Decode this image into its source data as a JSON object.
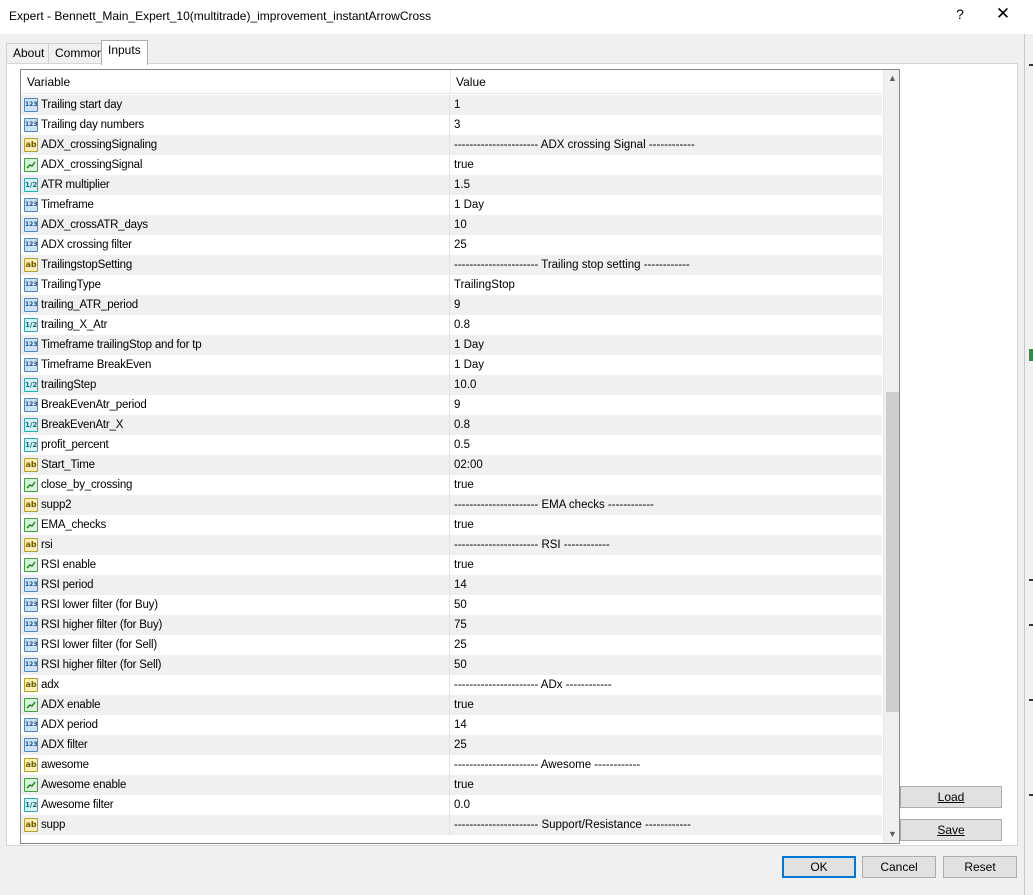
{
  "window": {
    "title": "Expert - Bennett_Main_Expert_10(multitrade)_improvement_instantArrowCross",
    "help_glyph": "?",
    "close_glyph": "✕"
  },
  "tabs": [
    {
      "label": "About"
    },
    {
      "label": "Common"
    },
    {
      "label": "Inputs",
      "active": true
    }
  ],
  "grid": {
    "col_variable": "Variable",
    "col_value": "Value",
    "rows": [
      {
        "type": "int",
        "icon": "int-icon",
        "name": "Trailing start day",
        "value": "1"
      },
      {
        "type": "int",
        "icon": "int-icon",
        "name": "Trailing day numbers",
        "value": "3"
      },
      {
        "type": "str",
        "icon": "string-icon",
        "name": "ADX_crossingSignaling",
        "value": "---------------------- ADX crossing Signal ------------"
      },
      {
        "type": "bool",
        "icon": "bool-icon",
        "name": "ADX_crossingSignal",
        "value": "true"
      },
      {
        "type": "dbl",
        "icon": "double-icon",
        "name": "ATR multiplier",
        "value": "1.5"
      },
      {
        "type": "int",
        "icon": "int-icon",
        "name": "Timeframe",
        "value": "1 Day"
      },
      {
        "type": "int",
        "icon": "int-icon",
        "name": "ADX_crossATR_days",
        "value": "10"
      },
      {
        "type": "int",
        "icon": "int-icon",
        "name": "ADX crossing filter",
        "value": "25"
      },
      {
        "type": "str",
        "icon": "string-icon",
        "name": "TrailingstopSetting",
        "value": "---------------------- Trailing stop setting ------------"
      },
      {
        "type": "int",
        "icon": "int-icon",
        "name": "TrailingType",
        "value": "TrailingStop"
      },
      {
        "type": "int",
        "icon": "int-icon",
        "name": "trailing_ATR_period",
        "value": "9"
      },
      {
        "type": "dbl",
        "icon": "double-icon",
        "name": "trailing_X_Atr",
        "value": "0.8"
      },
      {
        "type": "int",
        "icon": "int-icon",
        "name": "Timeframe trailingStop and for tp",
        "value": "1 Day"
      },
      {
        "type": "int",
        "icon": "int-icon",
        "name": "Timeframe BreakEven",
        "value": "1 Day"
      },
      {
        "type": "dbl",
        "icon": "double-icon",
        "name": "trailingStep",
        "value": "10.0"
      },
      {
        "type": "int",
        "icon": "int-icon",
        "name": "BreakEvenAtr_period",
        "value": "9"
      },
      {
        "type": "dbl",
        "icon": "double-icon",
        "name": "BreakEvenAtr_X",
        "value": "0.8"
      },
      {
        "type": "dbl",
        "icon": "double-icon",
        "name": "profit_percent",
        "value": "0.5"
      },
      {
        "type": "str",
        "icon": "string-icon",
        "name": "Start_Time",
        "value": "02:00"
      },
      {
        "type": "bool",
        "icon": "bool-icon",
        "name": "close_by_crossing",
        "value": "true"
      },
      {
        "type": "str",
        "icon": "string-icon",
        "name": "supp2",
        "value": "---------------------- EMA checks ------------"
      },
      {
        "type": "bool",
        "icon": "bool-icon",
        "name": "EMA_checks",
        "value": "true"
      },
      {
        "type": "str",
        "icon": "string-icon",
        "name": "rsi",
        "value": "---------------------- RSI ------------"
      },
      {
        "type": "bool",
        "icon": "bool-icon",
        "name": "RSI enable",
        "value": "true"
      },
      {
        "type": "int",
        "icon": "int-icon",
        "name": "RSI period",
        "value": "14"
      },
      {
        "type": "int",
        "icon": "int-icon",
        "name": "RSI lower filter (for Buy)",
        "value": "50"
      },
      {
        "type": "int",
        "icon": "int-icon",
        "name": "RSI higher filter (for Buy)",
        "value": "75"
      },
      {
        "type": "int",
        "icon": "int-icon",
        "name": "RSI lower filter (for Sell)",
        "value": "25"
      },
      {
        "type": "int",
        "icon": "int-icon",
        "name": "RSI higher filter (for Sell)",
        "value": "50"
      },
      {
        "type": "str",
        "icon": "string-icon",
        "name": "adx",
        "value": "---------------------- ADx ------------"
      },
      {
        "type": "bool",
        "icon": "bool-icon",
        "name": "ADX enable",
        "value": "true"
      },
      {
        "type": "int",
        "icon": "int-icon",
        "name": "ADX period",
        "value": "14"
      },
      {
        "type": "int",
        "icon": "int-icon",
        "name": "ADX filter",
        "value": "25"
      },
      {
        "type": "str",
        "icon": "string-icon",
        "name": "awesome",
        "value": "---------------------- Awesome ------------"
      },
      {
        "type": "bool",
        "icon": "bool-icon",
        "name": "Awesome enable",
        "value": "true"
      },
      {
        "type": "dbl",
        "icon": "double-icon",
        "name": "Awesome filter",
        "value": "0.0"
      },
      {
        "type": "str",
        "icon": "string-icon",
        "name": "supp",
        "value": "---------------------- Support/Resistance ------------"
      }
    ]
  },
  "side_buttons": {
    "load": "Load",
    "save": "Save"
  },
  "buttons": {
    "ok": "OK",
    "cancel": "Cancel",
    "reset": "Reset"
  },
  "icon_labels": {
    "int": "123",
    "str": "ab",
    "dbl": "1/2"
  },
  "colors": {
    "dialog_bg": "#f0f0f0",
    "row_alt": "#f0f0f0",
    "default_button_border": "#0078d7"
  }
}
